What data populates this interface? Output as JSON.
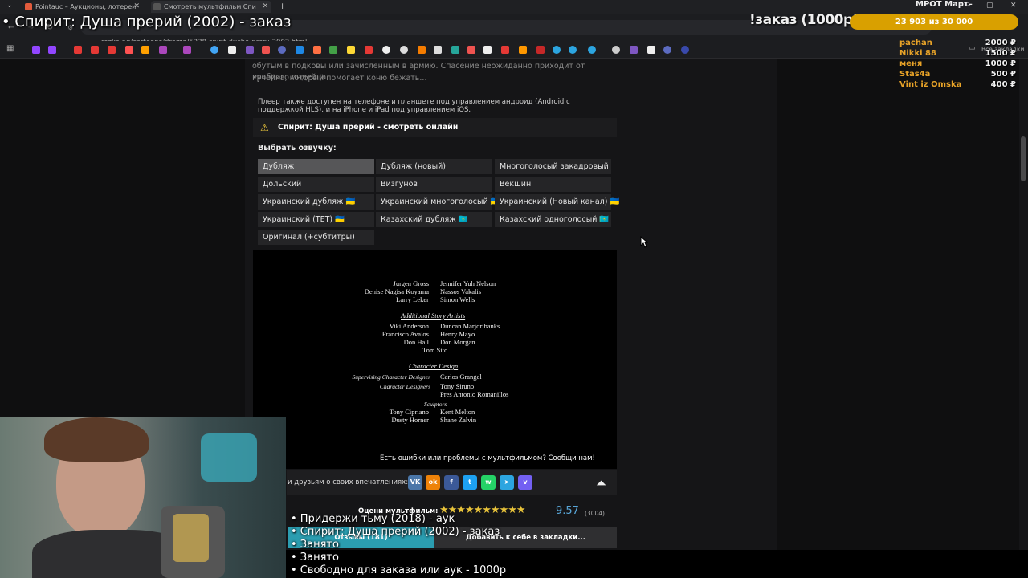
{
  "browser": {
    "tabs": [
      {
        "title": "Pointauc – Аукционы, лотереи",
        "color": "#e25b3c"
      },
      {
        "title": "Смотреть мультфильм Спи",
        "color": "#3a3a3d"
      }
    ],
    "new_tab_symbol": "+",
    "url": "rezka.ag/cartoons/drama/5238-spirit-dusha-prerij-2002.html",
    "bookmark_folder": "Все закладки",
    "window_controls": [
      "–",
      "▢",
      "✕"
    ]
  },
  "page": {
    "description_lines": [
      "обутым в подковы или зачисленным в армию. Спасение неожиданно приходит от храброго индейца",
      "Ручейка, который помогает коню бежать..."
    ],
    "device_note": "Плеер также доступен на телефоне и планшете под управлением андроид (Android с поддержкой HLS), и на iPhone и iPad под управлением iOS.",
    "player_title": "Спирит: Душа прерий - смотреть онлайн",
    "voice_label": "Выбрать озвучку:",
    "voices": [
      "Дубляж",
      "Дубляж (новый)",
      "Многоголосый закадровый",
      "Дольский",
      "Визгунов",
      "Векшин",
      "Украинский дубляж 🇺🇦",
      "Украинский многоголосый 🇺🇦",
      "Украинский (Новый канал) 🇺🇦",
      "Украинский (ТЕТ) 🇺🇦",
      "Казахский дубляж 🇰🇿",
      "Казахский одноголосый 🇰🇿",
      "Оригинал (+субтитры)"
    ],
    "active_voice": "Дубляж",
    "credits": {
      "left1": [
        "Jurgen Gross",
        "Denise Nagisa Koyama",
        "Larry Leker"
      ],
      "right1": [
        "Jennifer Yuh Nelson",
        "Nassos Vakalis",
        "Simon Wells"
      ],
      "heading_story": "Additional Story Artists",
      "left2": [
        "Viki Anderson",
        "Francisco Avalos",
        "Don Hall"
      ],
      "right2": [
        "Duncan Marjoribanks",
        "Henry Mayo",
        "Don Morgan"
      ],
      "center2": "Tom Sito",
      "heading_character": "Character Design",
      "supervising_label": "Supervising Character Designer",
      "supervising_name": "Carlos Grangel",
      "designers_label": "Character Designers",
      "designers_names": [
        "Tony Siruno",
        "Pres Antonio Romanillos"
      ],
      "sculptors_label": "Sculptors",
      "sculptors_left": [
        "Tony Cipriano",
        "Dusty Horner"
      ],
      "sculptors_right": [
        "Kent Melton",
        "Shane Zalvin"
      ]
    },
    "error_message": "Есть ошибки или проблемы с мультфильмом? Сообщи нам!",
    "share_label": "и друзьям о своих впечатлениях:",
    "share_icons": [
      {
        "name": "vk-icon",
        "label": "VK",
        "color": "#4a76a8"
      },
      {
        "name": "ok-icon",
        "label": "ok",
        "color": "#ee8208"
      },
      {
        "name": "facebook-icon",
        "label": "f",
        "color": "#3b5998"
      },
      {
        "name": "twitter-icon",
        "label": "t",
        "color": "#1da1f2"
      },
      {
        "name": "whatsapp-icon",
        "label": "w",
        "color": "#25d366"
      },
      {
        "name": "telegram-icon",
        "label": "➤",
        "color": "#2ca5e0"
      },
      {
        "name": "viber-icon",
        "label": "v",
        "color": "#7360f2"
      }
    ],
    "rating_label": "Оцени мультфильм:",
    "stars": "★★★★★★★★★★",
    "rating_value": "9.57",
    "rating_count": "(3004)",
    "reviews_tab": "Отзывы (181)",
    "bookmark_button": "Добавить к себе в закладки..."
  },
  "stream": {
    "title": "• Спирит: Душа прерий (2002) - заказ",
    "order_label": "!заказ (1000р)",
    "goal": "23 903  из 30 000",
    "top_label": "МРОТ Март–",
    "donors": [
      {
        "name": "pachan",
        "amount": "2000 ₽"
      },
      {
        "name": "Nikki 88",
        "amount": "1500 ₽"
      },
      {
        "name": "меня",
        "amount": "1000 ₽"
      },
      {
        "name": "Stas4a",
        "amount": "500 ₽"
      },
      {
        "name": "Vint iz Omska",
        "amount": "400 ₽"
      }
    ],
    "queue": [
      "• Придержи тьму (2018) - аук",
      "• Спирит: Душа прерий (2002) - заказ",
      "• Занято",
      "• Занято",
      "• Свободно для заказа или аук - 1000р"
    ]
  }
}
